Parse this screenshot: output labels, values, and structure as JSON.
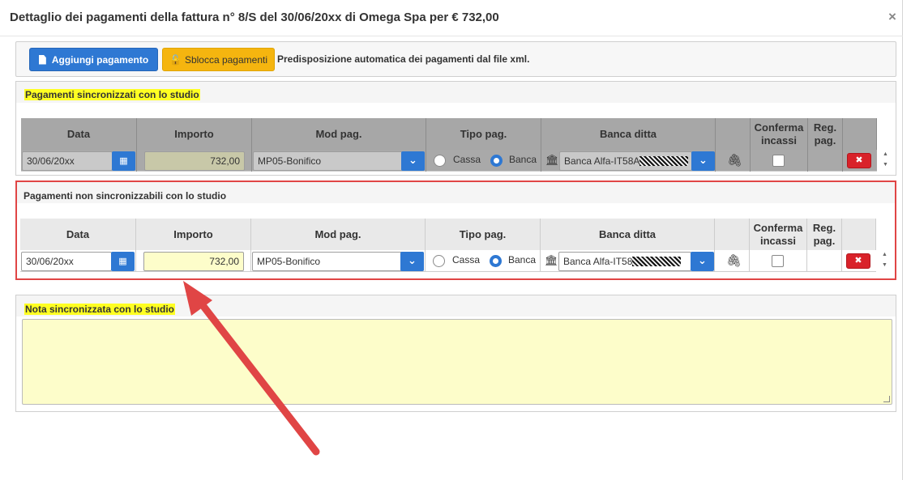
{
  "dialog": {
    "title": "Dettaglio dei pagamenti della fattura n° 8/S del 30/06/20xx di Omega Spa per € 732,00",
    "close_label": "×"
  },
  "toolbar": {
    "add_label": "Aggiungi pagamento",
    "unlock_label": "Sblocca pagamenti",
    "note": "Predisposizione automatica dei pagamenti dal file xml."
  },
  "columns": [
    "Data",
    "Importo",
    "Mod pag.",
    "Tipo pag.",
    "Banca ditta",
    "",
    "Conferma incassi",
    "Reg. pag.",
    ""
  ],
  "synced": {
    "title": "Pagamenti sincronizzati con lo studio",
    "row": {
      "date": "30/06/20xx",
      "amount": "732,00",
      "mode": "MP05-Bonifico",
      "type_options": [
        "Cassa",
        "Banca"
      ],
      "type_selected": "Banca",
      "bank": "Banca Alfa-IT58A",
      "confirm_checked": false
    }
  },
  "unsynced": {
    "title": "Pagamenti non sincronizzabili con lo studio",
    "row": {
      "date": "30/06/20xx",
      "amount": "732,00",
      "mode": "MP05-Bonifico",
      "type_options": [
        "Cassa",
        "Banca"
      ],
      "type_selected": "Banca",
      "bank": "Banca Alfa-IT58",
      "confirm_checked": false
    }
  },
  "note": {
    "title": "Nota sincronizzata con lo studio",
    "value": ""
  },
  "icons": {
    "calendar": "calendar-icon",
    "chevron": "chevron-down-icon",
    "bank": "bank-icon",
    "attach": "paperclip-icon",
    "delete": "close-icon",
    "lock": "unlock-icon",
    "doc": "document-icon"
  },
  "colors": {
    "primary": "#2e78d3",
    "warning": "#f5b50f",
    "danger": "#d9222a",
    "highlight": "#ffff22",
    "annotation": "#e04545"
  }
}
